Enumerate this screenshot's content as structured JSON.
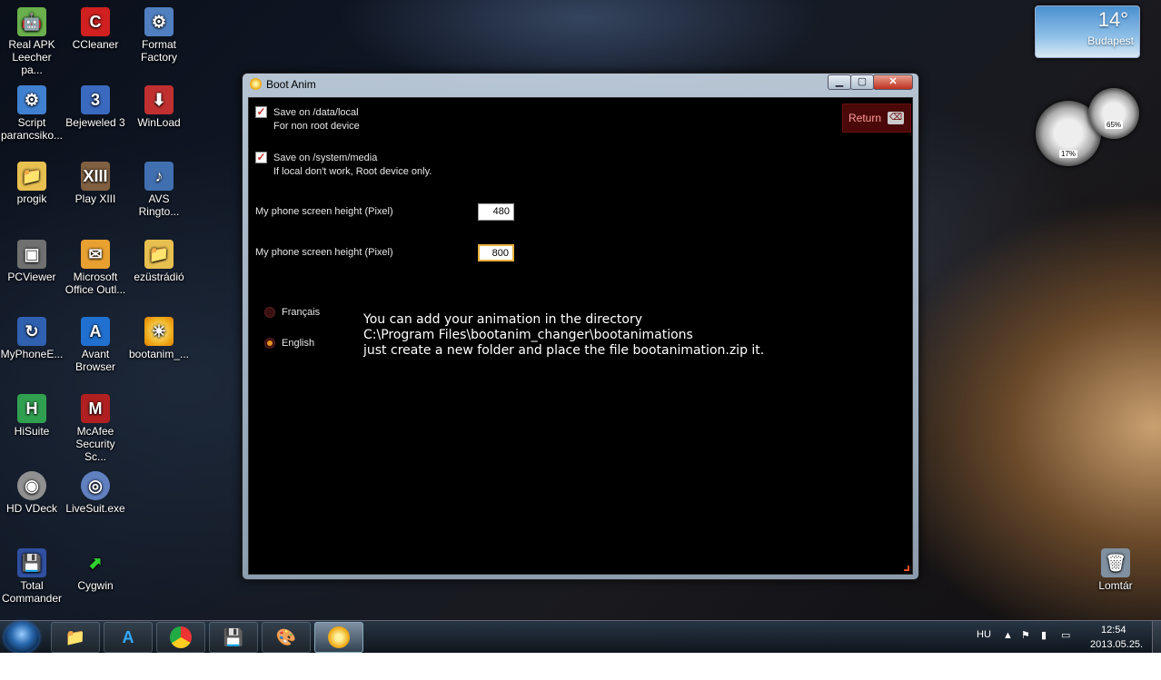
{
  "desktop": {
    "icons": [
      {
        "label": "Real APK Leecher pa...",
        "icon": "android-icon",
        "color": "#6ab04c"
      },
      {
        "label": "CCleaner",
        "icon": "ccleaner-icon",
        "color": "#d02020"
      },
      {
        "label": "Format Factory",
        "icon": "format-factory-icon",
        "color": "#5080c0"
      },
      {
        "label": "Script parancsiko...",
        "icon": "script-icon",
        "color": "#4080d0"
      },
      {
        "label": "Bejeweled 3",
        "icon": "bejeweled-icon",
        "color": "#3a6ac0"
      },
      {
        "label": "WinLoad",
        "icon": "winload-icon",
        "color": "#c03030"
      },
      {
        "label": "progik",
        "icon": "folder-icon",
        "color": "#e8c050"
      },
      {
        "label": "Play XIII",
        "icon": "play-xiii-icon",
        "color": "#806040"
      },
      {
        "label": "AVS Ringto...",
        "icon": "avs-ringtone-icon",
        "color": "#4070b0"
      },
      {
        "label": "PCViewer",
        "icon": "pcviewer-icon",
        "color": "#707070"
      },
      {
        "label": "Microsoft Office Outl...",
        "icon": "outlook-icon",
        "color": "#e8a030"
      },
      {
        "label": "ezüstrádió",
        "icon": "folder-icon",
        "color": "#e8c050"
      },
      {
        "label": "MyPhoneE...",
        "icon": "myphone-icon",
        "color": "#3060b0"
      },
      {
        "label": "Avant Browser",
        "icon": "avant-browser-icon",
        "color": "#2070d0"
      },
      {
        "label": "bootanim_...",
        "icon": "bootanim-icon",
        "color": "#f0b020"
      },
      {
        "label": "HiSuite",
        "icon": "hisuite-icon",
        "color": "#30a050"
      },
      {
        "label": "McAfee Security Sc...",
        "icon": "mcafee-icon",
        "color": "#b02020"
      },
      {
        "label": "HD VDeck",
        "icon": "hd-vdeck-icon",
        "color": "#909090"
      },
      {
        "label": "LiveSuit.exe",
        "icon": "livesuit-icon",
        "color": "#6080c0"
      },
      {
        "label": "Total Commander",
        "icon": "total-commander-icon",
        "color": "#3050a0"
      },
      {
        "label": "Cygwin",
        "icon": "cygwin-icon",
        "color": "#208020"
      },
      {
        "label": "Lomtár",
        "icon": "recycle-bin-icon",
        "color": "#8090a0"
      }
    ]
  },
  "weather": {
    "temp": "14°",
    "city": "Budapest"
  },
  "gadget": {
    "cpu": "17%",
    "mem": "65%"
  },
  "window": {
    "title": "Boot Anim",
    "return_label": "Return",
    "options": [
      {
        "label": "Save on /data/local",
        "sub": "For non root device",
        "checked": true
      },
      {
        "label": "Save on /system/media",
        "sub": "If local don't work, Root device only.",
        "checked": true
      }
    ],
    "fields": [
      {
        "label": "My phone screen height (Pixel)",
        "value": "480"
      },
      {
        "label": "My phone screen height (Pixel)",
        "value": "800"
      }
    ],
    "languages": [
      {
        "label": "Français",
        "selected": false
      },
      {
        "label": "English",
        "selected": true
      }
    ],
    "info": {
      "line1": "You can add your animation in the directory",
      "line2": "C:\\Program Files\\bootanim_changer\\bootanimations",
      "line3": "just create a new folder and place the file bootanimation.zip it."
    }
  },
  "taskbar": {
    "language": "HU",
    "time": "12:54",
    "date": "2013.05.25."
  }
}
